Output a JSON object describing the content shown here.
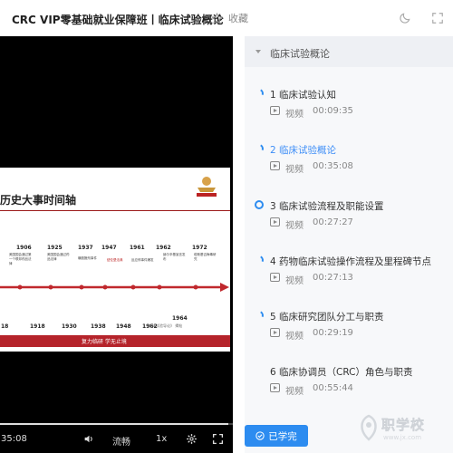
{
  "header": {
    "title": "CRC VIP零基础就业保障班丨临床试验概论",
    "favorite_label": "收藏"
  },
  "player": {
    "current_time": "35:08",
    "quality_label": "流畅",
    "speed_label": "1x",
    "progress_fraction": 0.98,
    "slide": {
      "heading": "历史大事时间轴",
      "logo_text": "复力临研",
      "footer": "复力临研 学无止境",
      "source": "《临床试验导论》 揭帖",
      "years_top": [
        "1906",
        "1925",
        "1937",
        "1947",
        "1961",
        "1962",
        "1972"
      ],
      "years_bottom": [
        "18",
        "1918",
        "1930",
        "1938",
        "1948",
        "1962",
        "1964"
      ],
      "events": [
        "美国国会通过第一个联邦药品法律",
        "美国国会通过药品法律",
        "磺胺酏剂事件",
        "纽伦堡法典",
        "反应停事件爆发",
        "赫尔辛基宣言发布",
        "塔斯基吉梅毒研究"
      ]
    }
  },
  "chapter": {
    "title": "临床试验概论"
  },
  "lessons": [
    {
      "title": "1  临床试验认知",
      "type": "视频",
      "duration": "00:09:35"
    },
    {
      "title": "2  临床试验概论",
      "type": "视频",
      "duration": "00:35:08"
    },
    {
      "title": "3  临床试验流程及职能设置",
      "type": "视频",
      "duration": "00:27:27"
    },
    {
      "title": "4  药物临床试验操作流程及里程碑节点",
      "type": "视频",
      "duration": "00:27:13"
    },
    {
      "title": "5  临床研究团队分工与职责",
      "type": "视频",
      "duration": "00:29:19"
    },
    {
      "title": "6  临床协调员（CRC）角色与职责",
      "type": "视频",
      "duration": "00:55:44"
    }
  ],
  "done_button": "已学完",
  "watermark": {
    "text": "职学校",
    "sub": "www.jx.com"
  }
}
